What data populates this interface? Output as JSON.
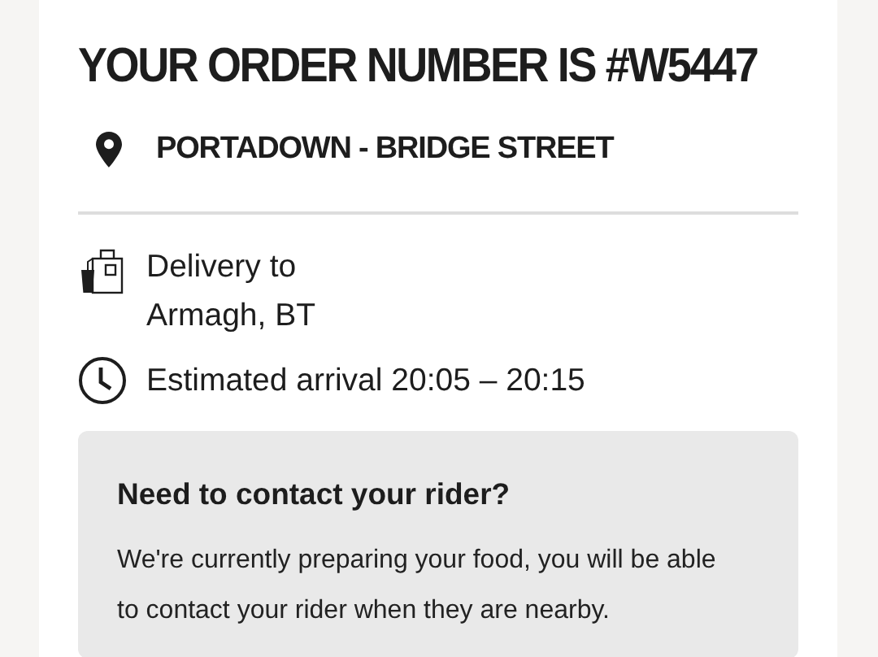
{
  "order_title": "YOUR ORDER NUMBER IS #W5447",
  "store": {
    "name": "PORTADOWN - BRIDGE STREET"
  },
  "delivery": {
    "label": "Delivery to",
    "address_line_2": "Armagh, BT"
  },
  "arrival": {
    "text": "Estimated arrival 20:05 – 20:15"
  },
  "contact_panel": {
    "heading": "Need to contact your rider?",
    "body": "We're currently preparing your food, you will be able to contact your rider when they are nearby."
  }
}
